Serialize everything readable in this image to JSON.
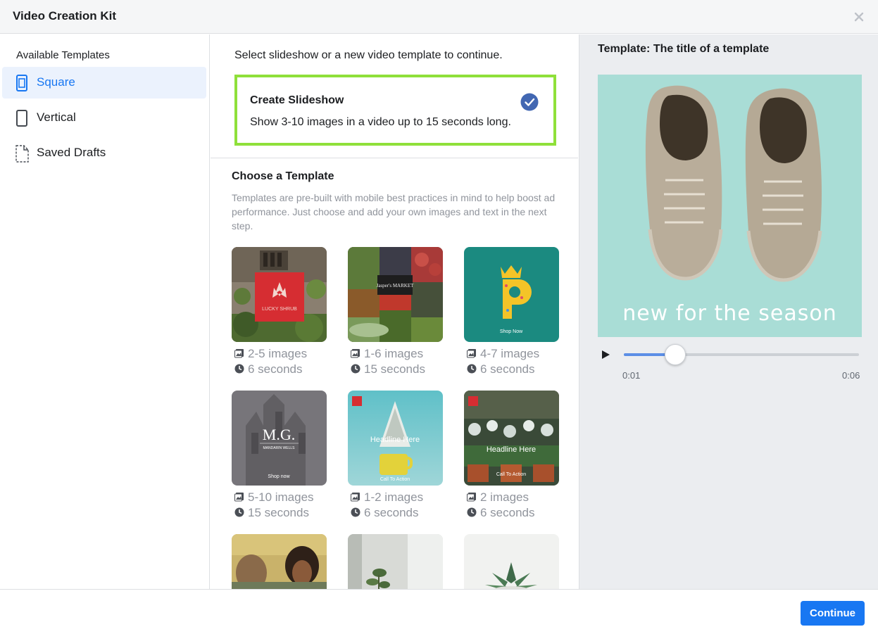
{
  "header": {
    "title": "Video Creation Kit"
  },
  "sidebar": {
    "heading": "Available Templates",
    "items": [
      {
        "label": "Square"
      },
      {
        "label": "Vertical"
      },
      {
        "label": "Saved Drafts"
      }
    ]
  },
  "main": {
    "select_prompt": "Select slideshow or a new video template to continue.",
    "slideshow": {
      "title": "Create Slideshow",
      "description": "Show 3-10 images in a video up to 15 seconds long."
    },
    "choose_title": "Choose a Template",
    "choose_description": "Templates are pre-built with mobile best practices in mind to help boost ad performance. Just choose and add your own images and text in the next step.",
    "templates": [
      {
        "images": "2-5 images",
        "duration": "6 seconds",
        "thumb_text": "LUCKY SHRUB"
      },
      {
        "images": "1-6 images",
        "duration": "15 seconds",
        "thumb_text": "Jasper's MARKET"
      },
      {
        "images": "4-7 images",
        "duration": "6 seconds",
        "thumb_text": "Shop Now"
      },
      {
        "images": "5-10 images",
        "duration": "15 seconds",
        "thumb_text": "M.G.",
        "thumb_sub": "MANDARIN WELLS",
        "thumb_cta": "Shop now"
      },
      {
        "images": "1-2 images",
        "duration": "6 seconds",
        "thumb_text": "Headline Here",
        "thumb_cta": "Call To Action"
      },
      {
        "images": "2 images",
        "duration": "6 seconds",
        "thumb_text": "Headline Here",
        "thumb_cta": "Call To Action"
      }
    ]
  },
  "preview": {
    "title": "Template: The title of a template",
    "caption": "new for the season",
    "time_current": "0:01",
    "time_total": "0:06",
    "progress": 0.22
  },
  "footer": {
    "continue_label": "Continue"
  },
  "colors": {
    "accent": "#1877f2",
    "selected_border": "#8fe03a",
    "preview_bg": "#a9ddd6"
  }
}
